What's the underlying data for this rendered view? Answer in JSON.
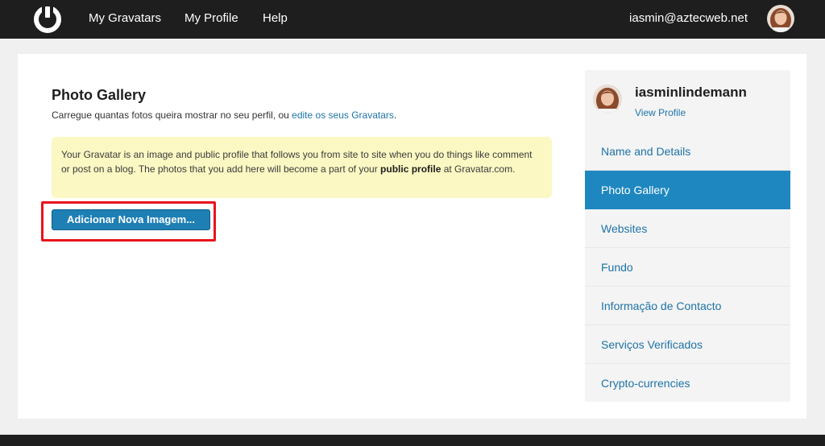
{
  "nav": {
    "items": [
      "My Gravatars",
      "My Profile",
      "Help"
    ],
    "email": "iasmin@aztecweb.net"
  },
  "main": {
    "title": "Photo Gallery",
    "subtitle_text": "Carregue quantas fotos queira mostrar no seu perfil, ou ",
    "subtitle_link": "edite os seus Gravatars",
    "subtitle_end": ".",
    "notice_text": "Your Gravatar is an image and public profile that follows you from site to site when you do things like comment or post on a blog. The photos that you add here will become a part of your ",
    "notice_bold": "public profile",
    "notice_end": " at Gravatar.com.",
    "add_button": "Adicionar Nova Imagem..."
  },
  "sidebar": {
    "username": "iasminlindemann",
    "view_profile": "View Profile",
    "items": [
      "Name and Details",
      "Photo Gallery",
      "Websites",
      "Fundo",
      "Informação de Contacto",
      "Serviços Verificados",
      "Crypto-currencies"
    ],
    "active_item": "Photo Gallery"
  },
  "colors": {
    "accent": "#1e87c0",
    "link": "#1e73a8",
    "topbar": "#1e1e1e",
    "notice_bg": "#fbf8c3",
    "highlight": "#e8141c"
  },
  "icons": {
    "logo": "gravatar-logo-icon"
  }
}
